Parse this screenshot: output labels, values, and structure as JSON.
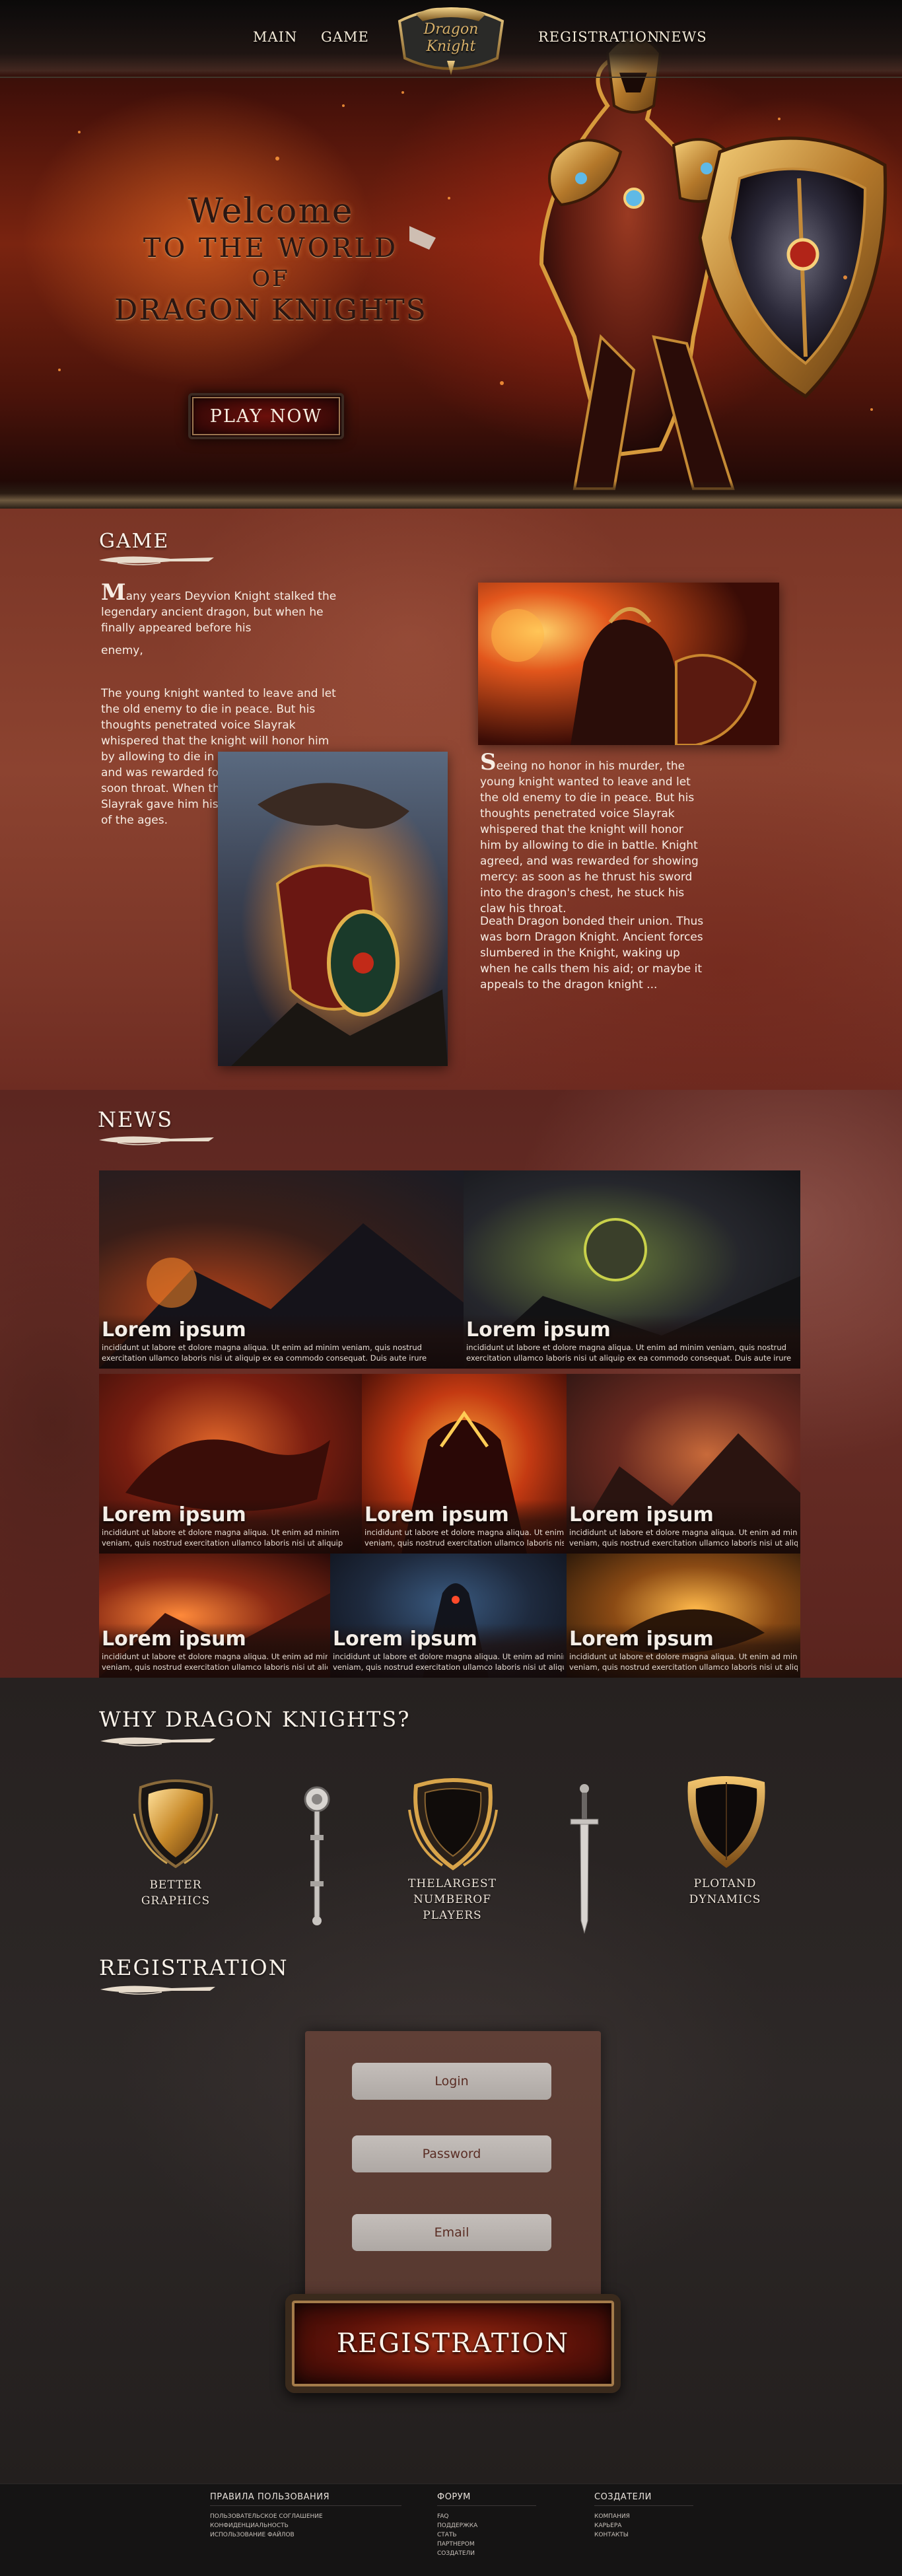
{
  "nav": {
    "main": "MAIN",
    "game": "GAME",
    "registration": "REGISTRATION",
    "news": "NEWS",
    "logo_text_top": "Dragon",
    "logo_text_bottom": "Knight"
  },
  "hero": {
    "welcome_line1": "Welcome",
    "welcome_line2": "TO THE WORLD",
    "welcome_line3": "OF",
    "welcome_line4": "DRAGON KNIGHTS",
    "play_button": "PLAY NOW"
  },
  "game": {
    "title": "GAME",
    "p1_cap": "M",
    "p1_rest": "any years Deyvion Knight stalked the legendary ancient dragon, but when he finally appeared before his",
    "p1_end": "enemy,",
    "p2": "The young knight wanted to leave and let the old enemy to die in peace. But his thoughts penetrated voice Slayrak whispered that the knight will honor him by allowing to die in battle. Knight agreed, and was rewarded for showing mercy: as soon  throat. When their blood was mixed, Slayrak gave him his firmness and wisdom of the ages.",
    "p3_cap": "S",
    "p3_rest": "eeing no honor in his murder, the young knight wanted to leave and let the old enemy to die in peace. But his thoughts penetrated voice Slayrak whispered that the knight will honor him by allowing to die in battle. Knight agreed, and was rewarded for showing mercy: as soon as he thrust his sword into the dragon's chest, he stuck his claw his throat.",
    "p4": "Death Dragon bonded their union. Thus was born Dragon Knight. Ancient forces slumbered in the Knight, waking up when he calls them his aid; or maybe it appeals to the dragon knight ..."
  },
  "news": {
    "title": "NEWS",
    "items": [
      {
        "title": "Lorem ipsum",
        "line1": "incididunt ut labore et dolore magna aliqua. Ut enim ad minim veniam, quis nostrud",
        "line2": "exercitation ullamco laboris nisi ut aliquip ex ea commodo consequat. Duis aute irure"
      },
      {
        "title": "Lorem ipsum",
        "line1": "incididunt ut labore et dolore magna aliqua. Ut enim ad minim veniam, quis nostrud",
        "line2": "exercitation ullamco laboris nisi ut aliquip ex ea commodo consequat. Duis aute irure"
      },
      {
        "title": "Lorem ipsum",
        "line1": "incididunt ut labore et dolore magna aliqua. Ut enim ad minim",
        "line2": "veniam, quis nostrud exercitation ullamco laboris nisi ut aliquip"
      },
      {
        "title": "Lorem ipsum",
        "line1": "incididunt ut labore et dolore magna aliqua. Ut enim ad minim",
        "line2": "veniam, quis nostrud exercitation ullamco laboris nisi ut aliquip"
      },
      {
        "title": "Lorem ipsum",
        "line1": "incididunt ut labore et dolore magna aliqua. Ut enim ad minim",
        "line2": "veniam, quis nostrud exercitation ullamco laboris nisi ut aliquip"
      },
      {
        "title": "Lorem ipsum",
        "line1": "incididunt ut labore et dolore magna aliqua. Ut enim ad minim",
        "line2": "veniam, quis nostrud exercitation ullamco laboris nisi ut aliquip"
      },
      {
        "title": "Lorem ipsum",
        "line1": "incididunt ut labore et dolore magna aliqua. Ut enim ad minim",
        "line2": "veniam, quis nostrud exercitation ullamco laboris nisi ut aliquip"
      },
      {
        "title": "Lorem ipsum",
        "line1": "incididunt ut labore et dolore magna aliqua. Ut enim ad minim",
        "line2": "veniam, quis nostrud exercitation ullamco laboris nisi ut aliquip"
      }
    ]
  },
  "why": {
    "title": "WHY DRAGON KNIGHTS?",
    "features": [
      {
        "line1": "BETTER",
        "line2": "GRAPHICS",
        "line3": ""
      },
      {
        "line1": "THELARGEST",
        "line2": "NUMBEROF",
        "line3": "PLAYERS"
      },
      {
        "line1": "PLOTAND",
        "line2": "DYNAMICS",
        "line3": ""
      }
    ]
  },
  "registration": {
    "title": "REGISTRATION",
    "login_placeholder": "Login",
    "password_placeholder": "Password",
    "email_placeholder": "Email",
    "button": "REGISTRATION"
  },
  "footer": {
    "col1": {
      "title": "ПРАВИЛА ПОЛЬЗОВАНИЯ",
      "links": [
        "ПОЛЬЗОВАТЕЛЬСКОЕ СОГЛАШЕНИЕ",
        "КОНФИДЕНЦИАЛЬНОСТЬ",
        "ИСПОЛЬЗОВАНИЕ ФАЙЛОВ"
      ]
    },
    "col2": {
      "title": "ФОРУМ",
      "links": [
        "FAQ",
        "ПОДДЕРЖКА",
        "СТАТЬ",
        "ПАРТНЕРОМ",
        "СОЗДАТЕЛИ"
      ]
    },
    "col3": {
      "title": "СОЗДАТЕЛИ",
      "links": [
        "КОМПАНИЯ",
        "КАРЬЕРА",
        "КОНТАКТЫ"
      ]
    }
  }
}
